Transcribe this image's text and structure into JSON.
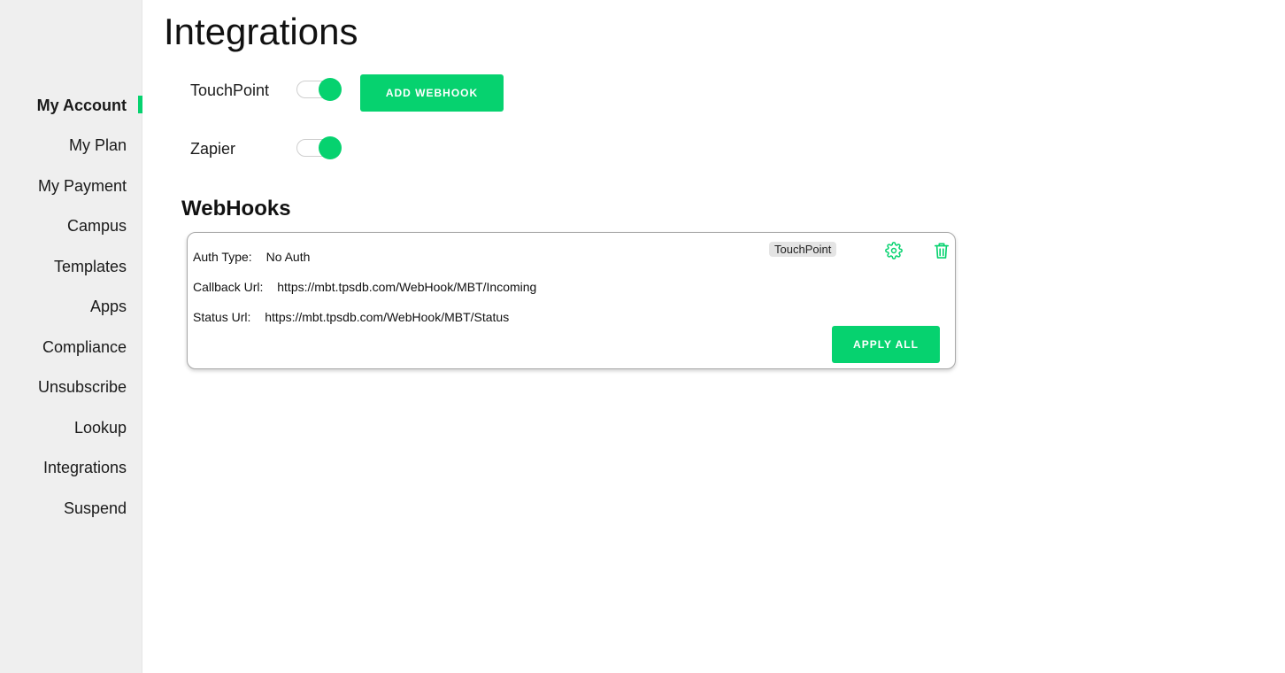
{
  "sidebar": {
    "items": [
      {
        "label": "My Account",
        "active": true
      },
      {
        "label": "My Plan",
        "active": false
      },
      {
        "label": "My Payment",
        "active": false
      },
      {
        "label": "Campus",
        "active": false
      },
      {
        "label": "Templates",
        "active": false
      },
      {
        "label": "Apps",
        "active": false
      },
      {
        "label": "Compliance",
        "active": false
      },
      {
        "label": "Unsubscribe",
        "active": false
      },
      {
        "label": "Lookup",
        "active": false
      },
      {
        "label": "Integrations",
        "active": false
      },
      {
        "label": "Suspend",
        "active": false
      }
    ]
  },
  "page": {
    "title": "Integrations"
  },
  "integrations": [
    {
      "label": "TouchPoint",
      "enabled": true
    },
    {
      "label": "Zapier",
      "enabled": true
    }
  ],
  "actions": {
    "add_webhook": "ADD WEBHOOK"
  },
  "webhooks": {
    "title": "WebHooks",
    "card": {
      "badge": "TouchPoint",
      "auth_type_label": "Auth Type:",
      "auth_type_value": "No Auth",
      "callback_label": "Callback Url:",
      "callback_value": "https://mbt.tpsdb.com/WebHook/MBT/Incoming",
      "status_label": "Status Url:",
      "status_value": "https://mbt.tpsdb.com/WebHook/MBT/Status",
      "apply_all": "APPLY ALL",
      "settings_icon": "gear-icon",
      "delete_icon": "trash-icon"
    }
  },
  "colors": {
    "accent": "#06d26f",
    "sidebar_bg": "#efefef"
  }
}
